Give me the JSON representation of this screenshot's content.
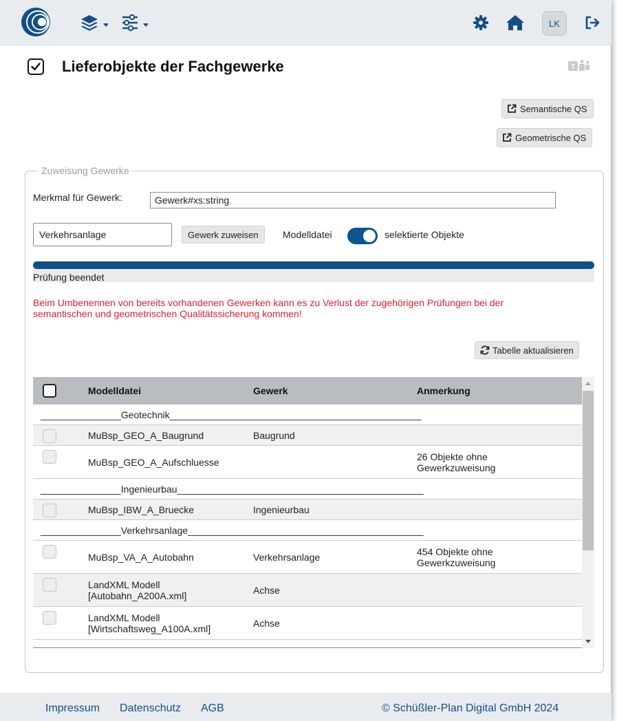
{
  "toolbar": {
    "logo_icon": "company-logo-circles",
    "layers_icon": "layers-icon",
    "filter_icon": "sliders-icon",
    "settings_icon": "gear-icon",
    "home_icon": "home-icon",
    "user_initials": "LK",
    "logout_icon": "logout-icon",
    "accent_color": "#124f87"
  },
  "page": {
    "title": "Lieferobjekte der Fachgewerke",
    "title_icon": "checkbox-checked-icon",
    "teams_icon": "ms-teams-icon"
  },
  "actions": {
    "semantic_qs": "Semantische QS",
    "geometric_qs": "Geometrische QS",
    "refresh_table": "Tabelle aktualisieren"
  },
  "assignment": {
    "legend": "Zuweisung Gewerke",
    "feature_label": "Merkmal für Gewerk:",
    "feature_value": "Gewerk#xs:string",
    "gewerk_value": "Verkehrsanlage",
    "assign_button": "Gewerk zuweisen",
    "toggle_left_label": "Modelldatei",
    "toggle_right_label": "selektierte Objekte",
    "toggle_on": true,
    "progress_percent": 100,
    "progress_status": "Prüfung beendet",
    "warning_line1": "Beim Umbenennen von bereits vorhandenen Gewerken kann es zu Verlust der zugehörigen Prüfungen bei der",
    "warning_line2": "semantischen und geometrischen Qualitätssicherung kommen!",
    "warning_color": "#e0202e"
  },
  "table": {
    "headers": {
      "modelldatei": "Modelldatei",
      "gewerk": "Gewerk",
      "anmerkung": "Anmerkung"
    },
    "rows": [
      {
        "type": "group",
        "label": "_______________Geotechnik_______________________________________________"
      },
      {
        "type": "item",
        "modelldatei": [
          "MuBsp_GEO_A_Baugrund"
        ],
        "gewerk": "Baugrund",
        "anmerkung": []
      },
      {
        "type": "item",
        "modelldatei": [
          "MuBsp_GEO_A_Aufschluesse"
        ],
        "gewerk": "",
        "anmerkung": [
          "26 Objekte ohne",
          "Gewerkzuweisung"
        ]
      },
      {
        "type": "group",
        "label": "_______________Ingenieurbau______________________________________________"
      },
      {
        "type": "item",
        "modelldatei": [
          "MuBsp_IBW_A_Bruecke"
        ],
        "gewerk": "Ingenieurbau",
        "anmerkung": []
      },
      {
        "type": "group",
        "label": "_______________Verkehrsanlage____________________________________________"
      },
      {
        "type": "item",
        "modelldatei": [
          "MuBsp_VA_A_Autobahn"
        ],
        "gewerk": "Verkehrsanlage",
        "anmerkung": [
          "454 Objekte ohne",
          "Gewerkzuweisung"
        ]
      },
      {
        "type": "item",
        "modelldatei": [
          "LandXML Modell",
          "[Autobahn_A200A.xml]"
        ],
        "gewerk": "Achse",
        "anmerkung": []
      },
      {
        "type": "item",
        "modelldatei": [
          "LandXML Modell",
          "[Wirtschaftsweg_A100A.xml]"
        ],
        "gewerk": "Achse",
        "anmerkung": []
      }
    ]
  },
  "footer": {
    "impressum": "Impressum",
    "datenschutz": "Datenschutz",
    "agb": "AGB",
    "copyright": "© Schüßler-Plan Digital GmbH 2024"
  }
}
